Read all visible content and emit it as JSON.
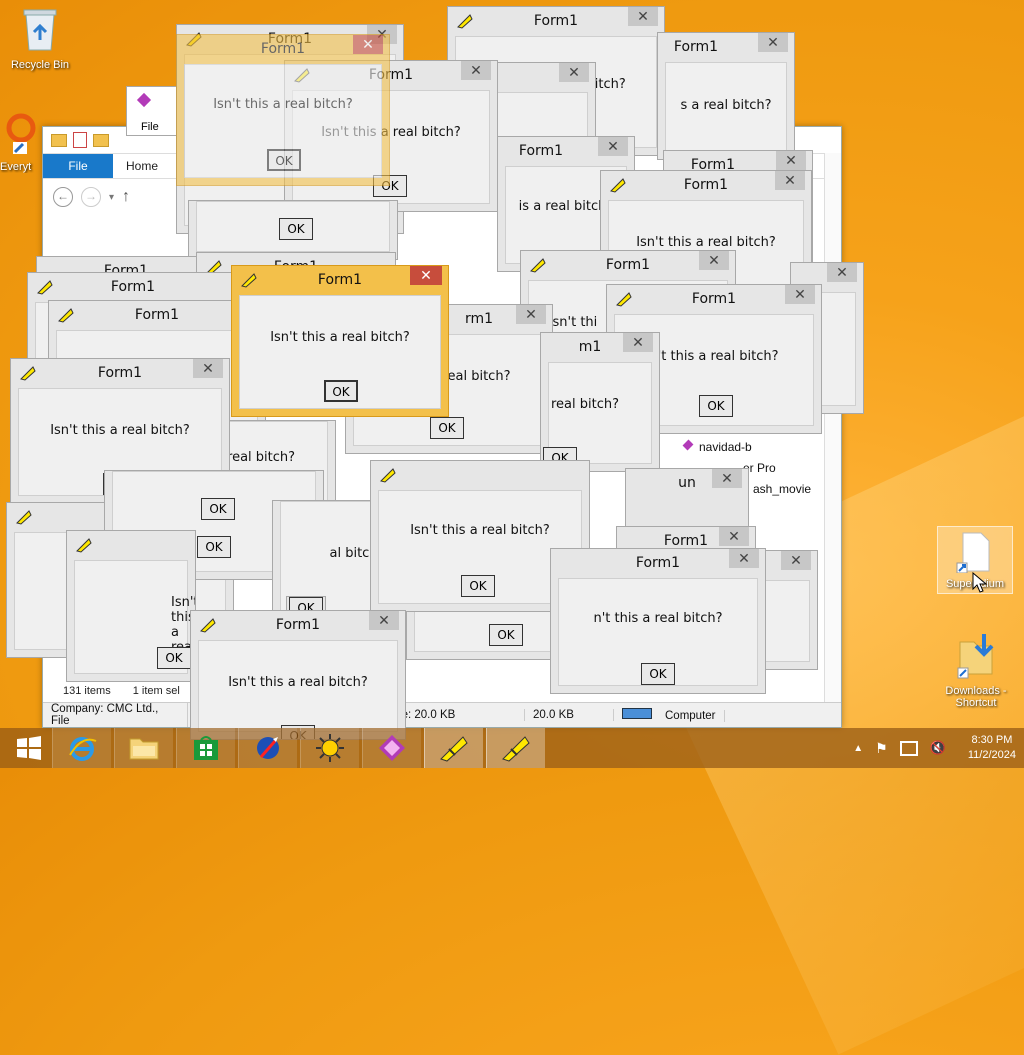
{
  "desktop": {
    "icons": [
      {
        "label": "Recycle Bin"
      },
      {
        "label": "Everyt"
      },
      {
        "label": "Superlidium"
      },
      {
        "label": "Downloads - Shortcut"
      }
    ]
  },
  "explorer": {
    "ribbon": {
      "file_tab": "File",
      "home_tab": "Home"
    },
    "files": [
      "navidad-b",
      "er Pro",
      "ash_movie"
    ],
    "item_count": "131 items",
    "selected": "1 item sel",
    "status": {
      "company": "Company: CMC Ltd., File",
      "date_size": "50 PM, Size: 20.0 KB",
      "size": "20.0 KB",
      "computer": "Computer"
    },
    "partial_labels": {
      "file": "File",
      "fo": "Fo",
      "isnt": "Isn't this",
      "form1_partial": "Form1",
      "is": "Is"
    }
  },
  "dialogs": {
    "title": "Form1",
    "message": "Isn't this a real bitch?",
    "ok": "OK",
    "close": "✕",
    "partial": {
      "a_real_bitch": "a real bitch?",
      "al_bitch": "al bitch?",
      "is_a_real_bitch": "is a real bitch?",
      "isnt_thi": "Isn't thi",
      "isnt_this_a_real": "Isn't this a real",
      "s_a_real_bitch": "s a real bitch?",
      "nt_this_a_real_bitch": "n't this a real bitch?",
      "isnt_this_a_real_bitch_mid": "Isn't this a real bitch?",
      "real_bitch": "real bitch?",
      "eal_bitch": "eal bitch?",
      "rm1": "rm1",
      "m1": "m1",
      "frm": "Form1",
      "un": "un",
      "nt_this": "n't this a real bitch?"
    }
  },
  "taskbar": {
    "clock_time": "8:30 PM",
    "clock_date": "11/2/2024"
  },
  "colors": {
    "desktop": "#ef9a10",
    "active_frame": "#f3c04a",
    "close_active": "#c74d3c",
    "ribbon_file": "#1979ca"
  }
}
